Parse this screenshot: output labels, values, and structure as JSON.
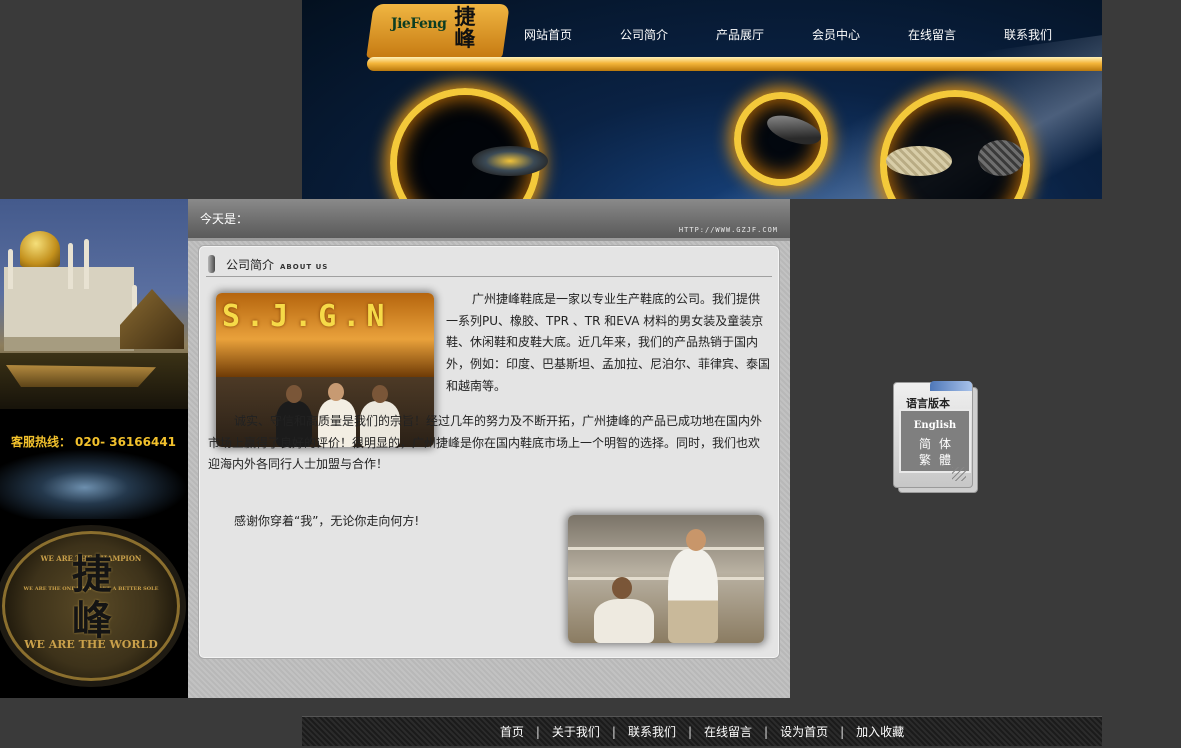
{
  "header": {
    "logo_latin": "JieFeng",
    "logo_cjk": "捷峰",
    "nav": [
      {
        "label": "网站首页"
      },
      {
        "label": "公司简介"
      },
      {
        "label": "产品展厅"
      },
      {
        "label": "会员中心"
      },
      {
        "label": "在线留言"
      },
      {
        "label": "联系我们"
      }
    ]
  },
  "sidebar": {
    "hotline_label": "客服热线：",
    "hotline_number": "020- 36166441",
    "emblem": {
      "cjk": "捷峰",
      "ring_top": "WE ARE THE CHAMPION",
      "ring_inner": "WE ARE THE ONE WHO MAKE A BETTER SOLE",
      "ring_bottom": "WE ARE THE WORLD"
    }
  },
  "main": {
    "date_label": "今天是：",
    "site_url": "HTTP://WWW.GZJF.COM",
    "panel": {
      "title": "公司简介",
      "subtitle": "ABOUT US",
      "photo1_sign": "S.J.G.N",
      "paragraphs": [
        "广州捷峰鞋底是一家以专业生产鞋底的公司。我们提供一系列PU、橡胶、TPR 、TR 和EVA 材料的男女装及童装京鞋、休闲鞋和皮鞋大底。近几年来，我们的产品热销于国内外，例如：印度、巴基斯坦、孟加拉、尼泊尔、菲律宾、泰国和越南等。",
        "诚实、守信和高质量是我们的宗旨！经过几年的努力及不断开拓，广州捷峰的产品已成功地在国内外市场上赢得了良好的评价！很明显的，广州捷峰是你在国内鞋底市场上一个明智的选择。同时，我们也欢迎海内外各同行人士加盟与合作！",
        "感谢你穿着“我”，无论你走向何方!"
      ]
    }
  },
  "language": {
    "title": "语言版本",
    "english": "English",
    "simplified": "简体",
    "traditional": "繁體"
  },
  "footer": {
    "links": [
      {
        "label": "首页"
      },
      {
        "label": "关于我们"
      },
      {
        "label": "联系我们"
      },
      {
        "label": "在线留言"
      },
      {
        "label": "设为首页"
      },
      {
        "label": "加入收藏"
      }
    ],
    "separator": "|"
  },
  "colors": {
    "page_bg": "#3a3a3a",
    "accent_gold": "#f4b53a",
    "hotline": "#f2c12c"
  }
}
